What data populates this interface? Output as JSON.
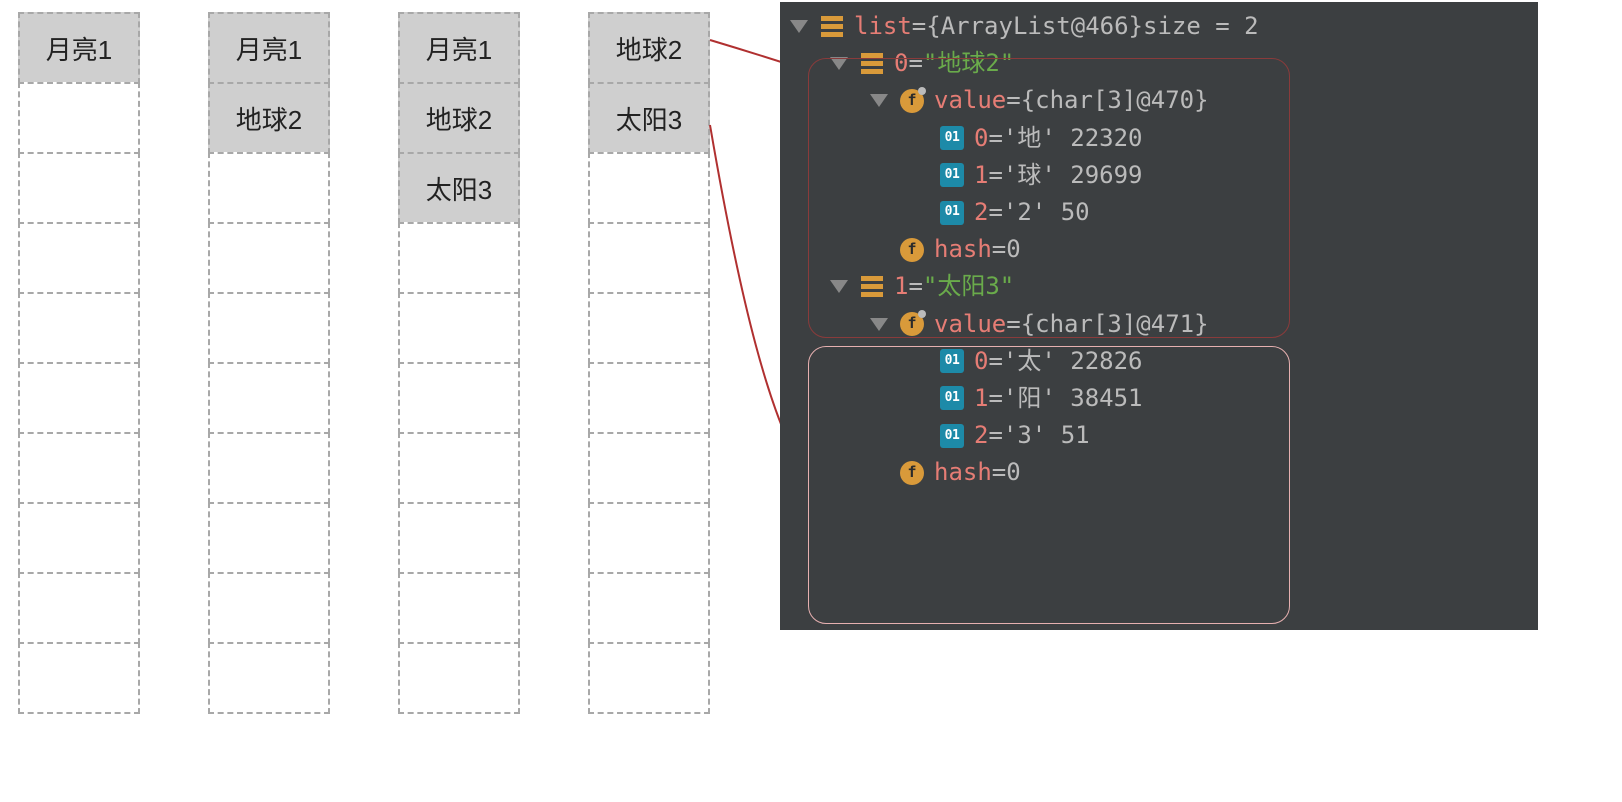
{
  "arrays": [
    {
      "size": 10,
      "filled": 1,
      "items": [
        "月亮1"
      ]
    },
    {
      "size": 10,
      "filled": 2,
      "items": [
        "月亮1",
        "地球2"
      ]
    },
    {
      "size": 10,
      "filled": 3,
      "items": [
        "月亮1",
        "地球2",
        "太阳3"
      ]
    },
    {
      "size": 10,
      "filled": 2,
      "items": [
        "地球2",
        "太阳3"
      ]
    }
  ],
  "debugger": {
    "root": {
      "name": "list",
      "eq": " = ",
      "value": "{ArrayList@466} ",
      "sizeLabel": " size = 2"
    },
    "entries": [
      {
        "idx": "0",
        "eq": " = ",
        "str": "\"地球2\"",
        "value": {
          "name": "value",
          "eq": " = ",
          "ref": "{char[3]@470}"
        },
        "chars": [
          {
            "idx": "0",
            "eq": " = ",
            "val": "'地' 22320"
          },
          {
            "idx": "1",
            "eq": " = ",
            "val": "'球' 29699"
          },
          {
            "idx": "2",
            "eq": " = ",
            "val": "'2' 50"
          }
        ],
        "hash": {
          "name": "hash",
          "eq": " = ",
          "val": "0"
        }
      },
      {
        "idx": "1",
        "eq": " = ",
        "str": "\"太阳3\"",
        "value": {
          "name": "value",
          "eq": " = ",
          "ref": "{char[3]@471}"
        },
        "chars": [
          {
            "idx": "0",
            "eq": " = ",
            "val": "'太' 22826"
          },
          {
            "idx": "1",
            "eq": " = ",
            "val": "'阳' 38451"
          },
          {
            "idx": "2",
            "eq": " = ",
            "val": "'3' 51"
          }
        ],
        "hash": {
          "name": "hash",
          "eq": " = ",
          "val": "0"
        }
      }
    ]
  }
}
